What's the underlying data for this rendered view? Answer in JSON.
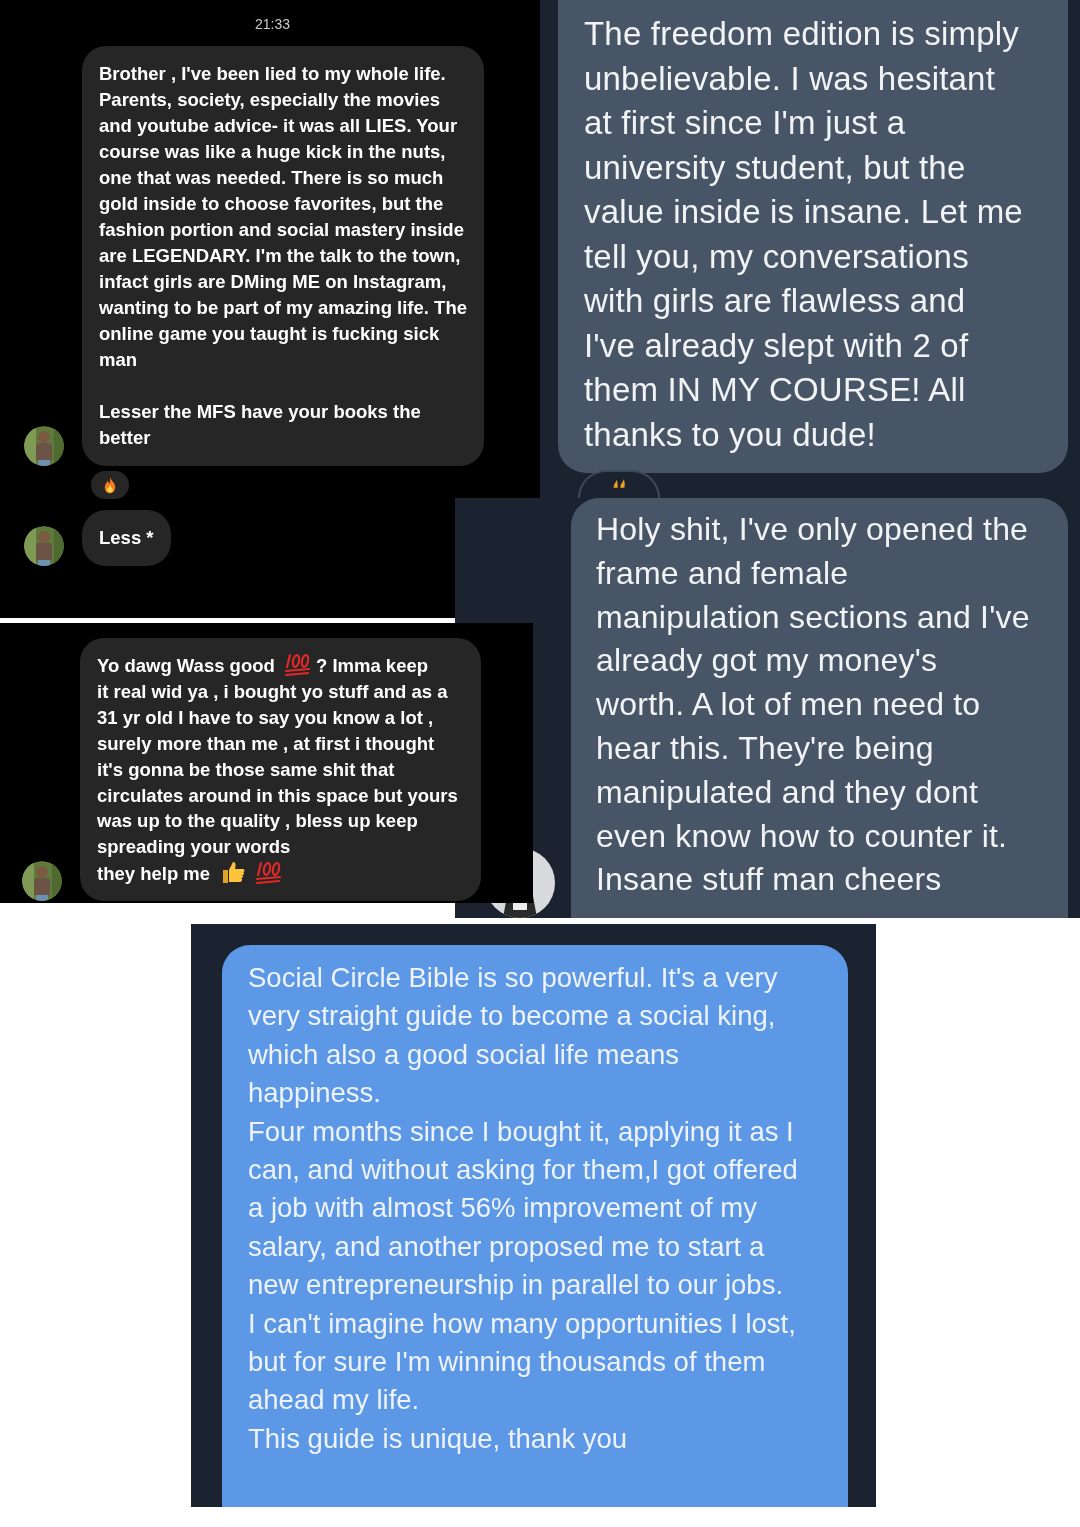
{
  "screenshots": [
    {
      "kind": "dark-dm",
      "time": "21:33",
      "messages": [
        {
          "avatar": true,
          "reacted": true,
          "segments": [
            {
              "kind": "text",
              "text": "Brother , I've been lied to my whole life. Parents, society, especially the movies and youtube advice- it was all LIES. Your course was like a huge kick in the nuts, one that was needed. There is so much gold inside to choose favorites, but the fashion portion and social mastery inside are LEGENDARY. I'm the talk to the town, infact girls are DMing ME on Instagram, wanting to be part of my amazing life. The online game you taught is fucking sick man"
            },
            {
              "kind": "break"
            },
            {
              "kind": "text",
              "text": "Lesser the MFS have your books the better"
            }
          ]
        },
        {
          "avatar": true,
          "reacted": false,
          "segments": [
            {
              "kind": "text",
              "text": "Less *"
            }
          ]
        }
      ]
    },
    {
      "kind": "slate-dm",
      "messages": [
        {
          "avatar": false,
          "reacted": true,
          "segments": [
            {
              "kind": "text",
              "text": "The freedom edition is simply unbelievable. I was hesitant at first since I'm just a university student, but the value inside is insane. Let me tell you, my conversations with girls are flawless and I've already slept with 2 of them IN MY COURSE! All thanks to you dude!"
            }
          ]
        }
      ]
    },
    {
      "kind": "dark-dm",
      "messages": [
        {
          "avatar": true,
          "reacted": false,
          "segments": [
            {
              "kind": "text",
              "text": "Yo dawg Wass good"
            },
            {
              "kind": "hundred"
            },
            {
              "kind": "text",
              "text": "? Imma keep"
            },
            {
              "kind": "paragraph",
              "text": "it real wid ya , i bought yo stuff and as a 31 yr old I have to say you know a lot , surely more than me , at first i thought it's gonna be those same shit that circulates around in this space but yours was up to the quality , bless up keep spreading your words"
            },
            {
              "kind": "text",
              "text": "they help me"
            },
            {
              "kind": "thumbs-up"
            },
            {
              "kind": "hundred"
            }
          ]
        }
      ]
    },
    {
      "kind": "slate-dm",
      "messages": [
        {
          "avatar": true,
          "reacted": false,
          "segments": [
            {
              "kind": "text",
              "text": "Holy shit, I've only opened the frame and female manipulation sections and I've already got my money's worth. A lot of men need to hear this. They're being manipulated and they dont even know how to counter it. Insane stuff man cheers"
            }
          ]
        }
      ]
    },
    {
      "kind": "blue-dm",
      "messages": [
        {
          "avatar": false,
          "reacted": false,
          "segments": [
            {
              "kind": "text",
              "text": "Social Circle Bible is so powerful. It's a very very straight guide to become a social king, which also a good social life means happiness."
            },
            {
              "kind": "break-tight"
            },
            {
              "kind": "text",
              "text": "Four months since I bought it, applying it as I can, and without asking for them,I got offered a job with almost 56% improvement of my salary, and another proposed me to start a new entrepreneurship in parallel to our jobs."
            },
            {
              "kind": "break-tight"
            },
            {
              "kind": "text",
              "text": "I can't imagine how many opportunities I lost, but for sure I'm winning thousands of them ahead my life."
            },
            {
              "kind": "break-tight"
            },
            {
              "kind": "text",
              "text": "This guide is unique, thank you"
            }
          ]
        }
      ]
    }
  ]
}
